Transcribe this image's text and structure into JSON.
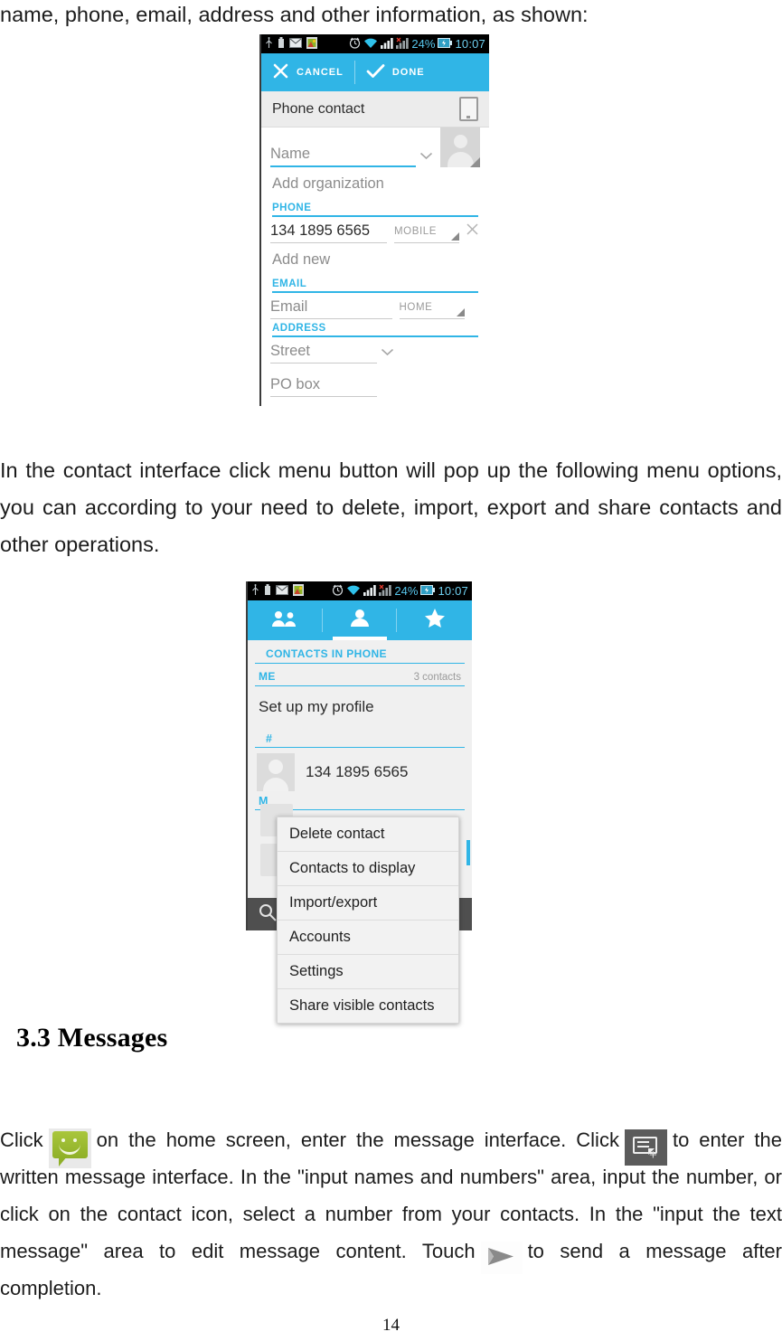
{
  "document": {
    "intro_line": "name, phone, email, address and other information, as shown:",
    "paragraph_menu": "In the contact interface click menu button will pop up the following menu options, you can according to your need to delete, import, export and share contacts and other operations.",
    "heading_messages": "3.3 Messages",
    "messages_para_part1": "Click",
    "messages_para_part2": "on the home screen, enter the message interface. Click",
    "messages_para_part3": "to enter the written message interface. In the \"input names and numbers\" area, input the number, or click on the contact icon, select a number from your contacts. In the \"input the text message\" area to edit message content. Touch",
    "messages_para_part4": "to send a message after completion.",
    "page_number": "14",
    "inline_icons": {
      "sms_app": "sms-app-icon",
      "new_message": "new-message-icon",
      "send": "send-icon"
    }
  },
  "screenshot_contact_edit": {
    "status_bar": {
      "battery_percent": "24%",
      "time": "10:07",
      "icons": [
        "usb-icon",
        "battery-icon",
        "email-icon",
        "gallery-icon",
        "alarm-icon",
        "wifi-icon",
        "signal-icon",
        "signal-off-icon",
        "battery-charging-icon"
      ]
    },
    "action_bar": {
      "cancel_label": "CANCEL",
      "done_label": "DONE"
    },
    "account_row": {
      "label": "Phone contact",
      "icon": "phone-device-icon"
    },
    "fields": {
      "name_placeholder": "Name",
      "add_organization": "Add organization",
      "phone_section": "PHONE",
      "phone_value": "134 1895 6565",
      "phone_type": "MOBILE",
      "add_new": "Add new",
      "email_section": "EMAIL",
      "email_placeholder": "Email",
      "email_type": "HOME",
      "address_section": "ADDRESS",
      "street_placeholder": "Street",
      "pobox_placeholder": "PO box"
    }
  },
  "screenshot_contacts_menu": {
    "status_bar": {
      "battery_percent": "24%",
      "time": "10:07"
    },
    "tabs": [
      {
        "name": "groups-tab",
        "icon": "groups-icon",
        "active": false
      },
      {
        "name": "contacts-tab",
        "icon": "person-icon",
        "active": true
      },
      {
        "name": "favorites-tab",
        "icon": "star-icon",
        "active": false
      }
    ],
    "section_header": "CONTACTS IN PHONE",
    "me_label": "ME",
    "me_count": "3 contacts",
    "profile_row": "Set up my profile",
    "hash_header": "#",
    "contact_name": "134 1895 6565",
    "letter_header": "M",
    "menu_items": [
      "Delete contact",
      "Contacts to display",
      "Import/export",
      "Accounts",
      "Settings",
      "Share visible contacts"
    ],
    "bottom_bar": {
      "search_icon": "search-icon",
      "add_contact_icon": "add-contact-icon"
    }
  },
  "colors": {
    "accent_blue": "#30b5e6",
    "status_bar_black": "#000000",
    "bottom_bar_grey": "#4f4f4f",
    "sms_green": "#a9c63c"
  }
}
